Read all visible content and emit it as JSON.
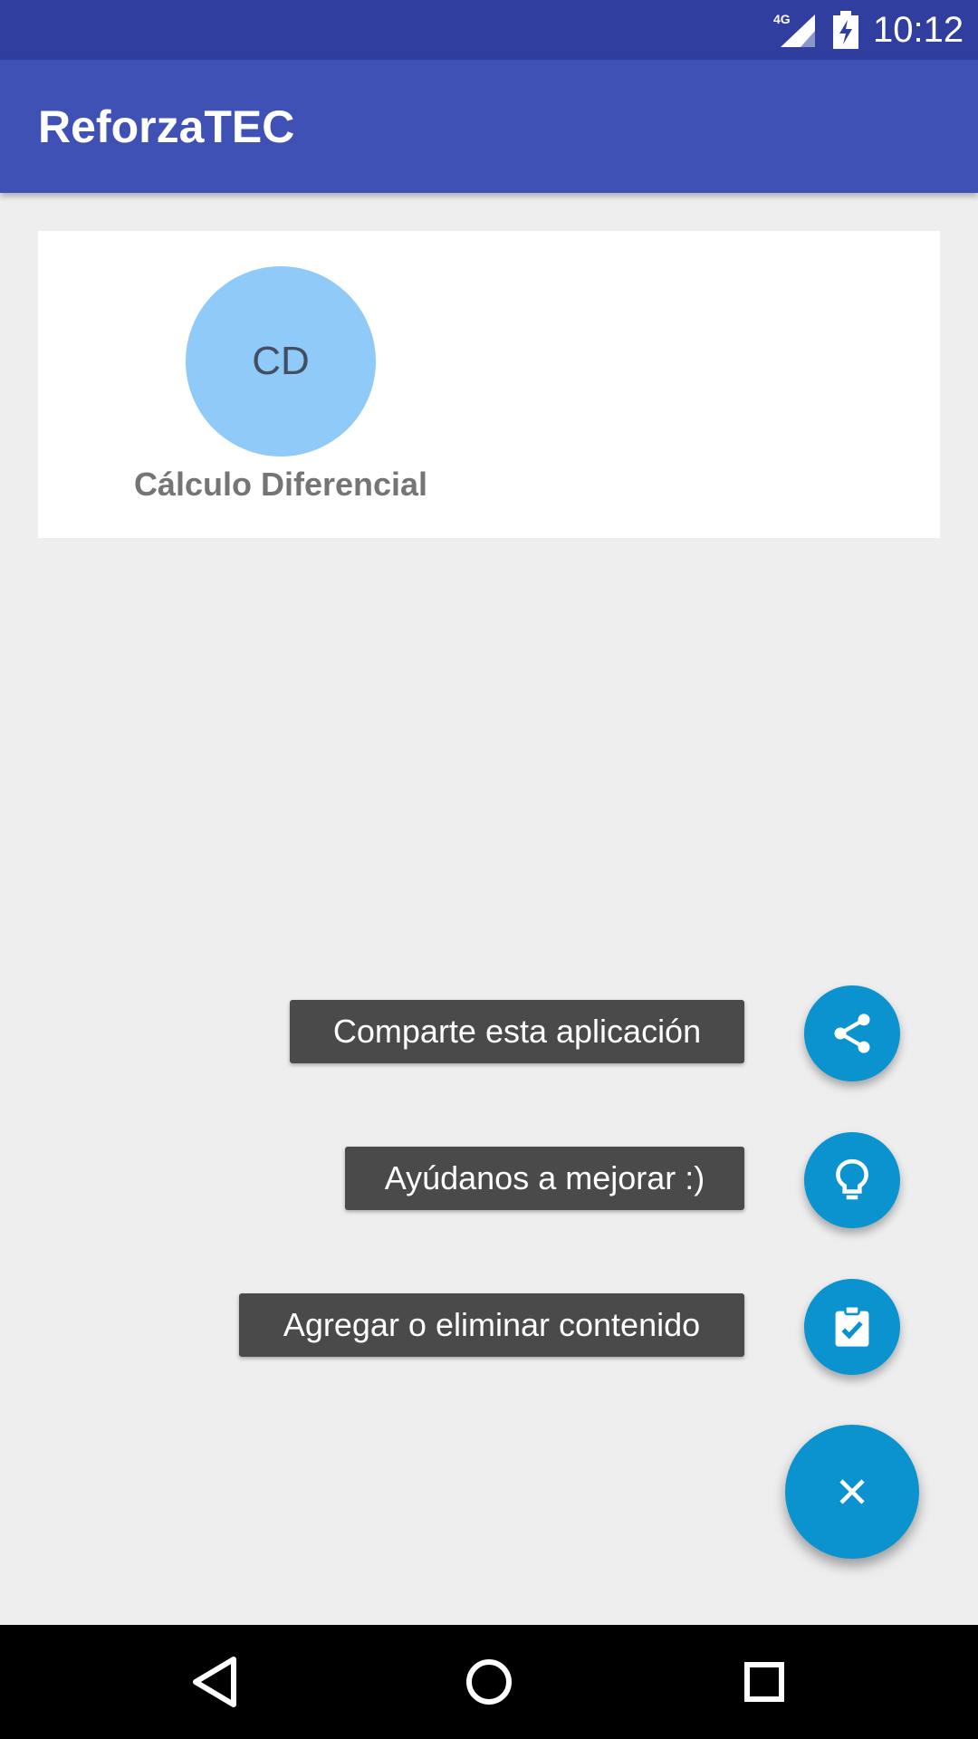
{
  "status_bar": {
    "network": "4G",
    "time": "10:12"
  },
  "app_bar": {
    "title": "ReforzaTEC"
  },
  "courses": [
    {
      "initials": "CD",
      "name": "Cálculo Diferencial",
      "avatar_color": "#90caf9"
    }
  ],
  "fab_menu": {
    "items": [
      {
        "label": "Comparte esta aplicación",
        "icon": "share-icon"
      },
      {
        "label": "Ayúdanos a mejorar :)",
        "icon": "lightbulb-icon"
      },
      {
        "label": "Agregar o eliminar contenido",
        "icon": "clipboard-check-icon"
      }
    ],
    "main_icon": "close-icon",
    "accent_color": "#0a93cf"
  },
  "colors": {
    "primary": "#3f51b5",
    "primary_dark": "#303f9f",
    "background": "#eeeeee"
  },
  "nav_bar": {
    "buttons": [
      "back-icon",
      "home-icon",
      "recents-icon"
    ]
  }
}
